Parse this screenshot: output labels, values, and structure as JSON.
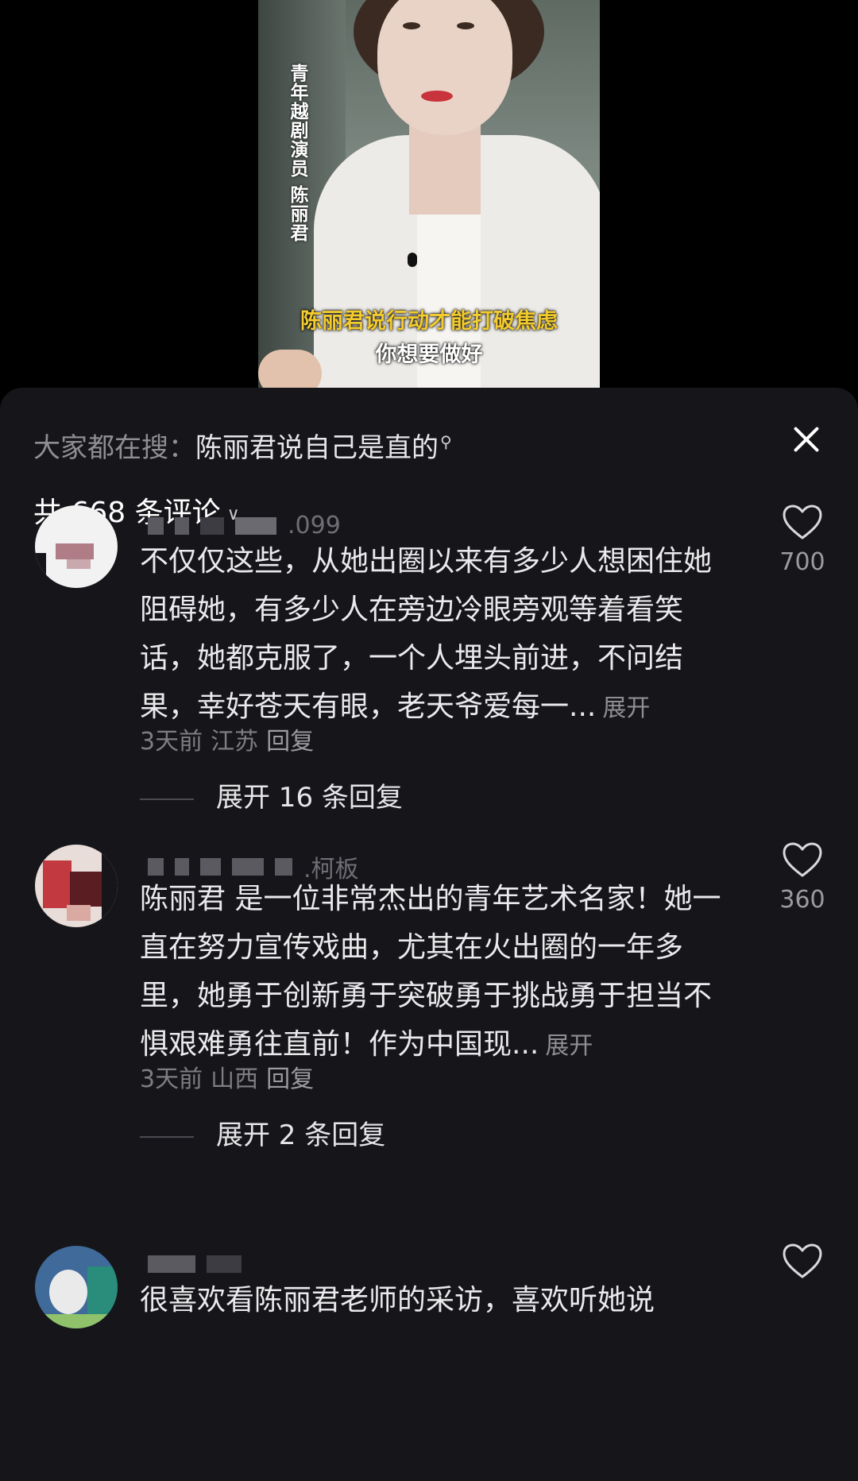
{
  "video": {
    "vertical_title": "青年越剧演员 陈丽君",
    "caption_yellow": "陈丽君说行动才能打破焦虑",
    "caption_white": "你想要做好"
  },
  "sheet": {
    "search_prefix": "大家都在搜：",
    "search_term": "陈丽君说自己是直的",
    "comment_count": "共 668 条评论",
    "icons": [
      "search-icon",
      "close-icon",
      "chevron-down-icon",
      "heart-icon"
    ]
  },
  "comments": [
    {
      "username_visible": ".099",
      "text": "不仅仅这些，从她出圈以来有多少人想困住她阻碍她，有多少人在旁边冷眼旁观等着看笑话，她都克服了，一个人埋头前进，不问结果，幸好苍天有眼，老天爷爱每一...",
      "expand_label": "展开",
      "time": "3天前",
      "location": "江苏",
      "reply_label": "回复",
      "likes": "700",
      "more_replies": "展开 16 条回复"
    },
    {
      "username_visible": ".柯板",
      "text": "陈丽君 是一位非常杰出的青年艺术名家！她一直在努力宣传戏曲，尤其在火出圈的一年多里，她勇于创新勇于突破勇于挑战勇于担当不惧艰难勇往直前！作为中国现...",
      "expand_label": "展开",
      "time": "3天前",
      "location": "山西",
      "reply_label": "回复",
      "likes": "360",
      "more_replies": "展开 2 条回复"
    },
    {
      "username_visible": "",
      "text": "很喜欢看陈丽君老师的采访，喜欢听她说",
      "likes": ""
    }
  ]
}
